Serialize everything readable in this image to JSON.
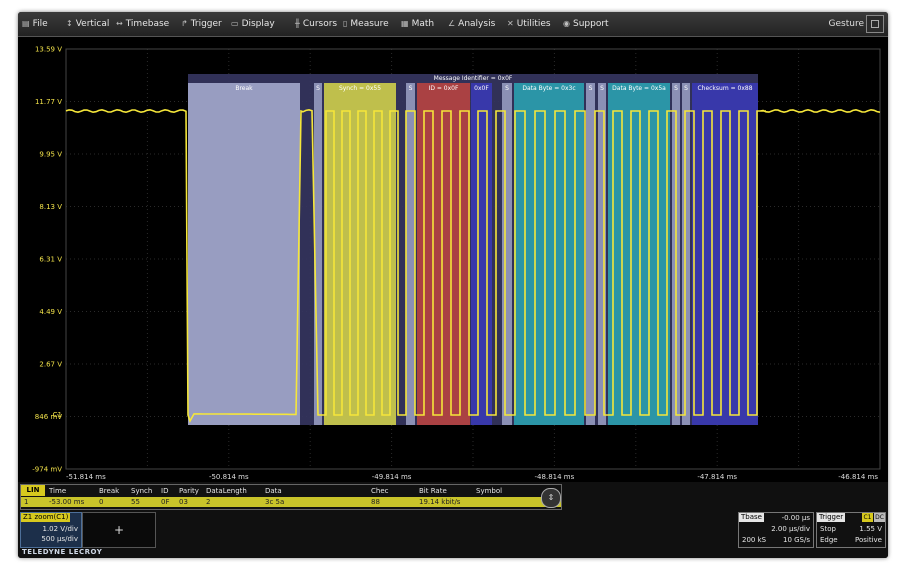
{
  "menu": {
    "items": [
      {
        "label": "File",
        "icon": "folder-icon"
      },
      {
        "label": "Vertical",
        "icon": "vertical-icon"
      },
      {
        "label": "Timebase",
        "icon": "timebase-icon"
      },
      {
        "label": "Trigger",
        "icon": "trigger-icon"
      },
      {
        "label": "Display",
        "icon": "display-icon"
      },
      {
        "label": "Cursors",
        "icon": "cursors-icon"
      },
      {
        "label": "Measure",
        "icon": "measure-icon"
      },
      {
        "label": "Math",
        "icon": "math-icon"
      },
      {
        "label": "Analysis",
        "icon": "analysis-icon"
      },
      {
        "label": "Utilities",
        "icon": "utilities-icon"
      },
      {
        "label": "Support",
        "icon": "support-icon"
      }
    ],
    "right_label": "Gesture"
  },
  "scope": {
    "y_ticks": [
      "13.59 V",
      "11.77 V",
      "9.95 V",
      "8.13 V",
      "6.31 V",
      "4.49 V",
      "2.67 V",
      "846 mV",
      "-974 mV"
    ],
    "x_ticks": [
      "-51.814 ms",
      "-50.814 ms",
      "-49.814 ms",
      "-48.814 ms",
      "-47.814 ms",
      "-46.814 ms"
    ],
    "channel_marker": "C1",
    "message_label": "Message Identifier = 0x0F",
    "segments": [
      {
        "label": "Break",
        "color": "#aab0d4"
      },
      {
        "label": "S",
        "color": "#aab0d4"
      },
      {
        "label": "Synch = 0x55",
        "color": "#d8d84a"
      },
      {
        "label": "S",
        "color": "#aab0d4"
      },
      {
        "label": "ID = 0x0F",
        "color": "#c0443f"
      },
      {
        "label": "0x0F",
        "color": "#3a3ab8"
      },
      {
        "label": "S",
        "color": "#aab0d4"
      },
      {
        "label": "Data Byte = 0x3c",
        "color": "#2aa7b5"
      },
      {
        "label": "S",
        "color": "#aab0d4"
      },
      {
        "label": "S",
        "color": "#aab0d4"
      },
      {
        "label": "Data Byte = 0x5a",
        "color": "#2aa7b5"
      },
      {
        "label": "S",
        "color": "#aab0d4"
      },
      {
        "label": "S",
        "color": "#aab0d4"
      },
      {
        "label": "Checksum = 0x88",
        "color": "#3a3ab8"
      }
    ],
    "trace_color": "#f5e63a"
  },
  "decode_table": {
    "tag": "LIN",
    "headers": [
      "Time",
      "Break",
      "Synch",
      "ID",
      "Parity",
      "DataLength",
      "Data",
      "Chec",
      "Bit Rate",
      "Symbol"
    ],
    "row": [
      "-53.00 ms",
      "0",
      "55",
      "0F",
      "03",
      "2",
      "3c 5a",
      "88",
      "19.14 kbit/s",
      ""
    ],
    "row_index": "1"
  },
  "zoom": {
    "tag": "Z1",
    "tag_suffix": "zoom(C1)",
    "vdiv": "1.02 V/div",
    "tdiv": "500 µs/div",
    "thumb": "+"
  },
  "brand": "TELEDYNE LECROY",
  "timebase": {
    "tag": "Tbase",
    "offset": "-0.00 µs",
    "tdiv": "2.00 µs/div",
    "samples": "200 kS",
    "rate": "10 GS/s"
  },
  "trigger": {
    "tag": "Trigger",
    "ch": "C1",
    "coupling": "DC",
    "mode": "Stop",
    "level": "1.55 V",
    "type": "Edge",
    "slope": "Positive"
  }
}
